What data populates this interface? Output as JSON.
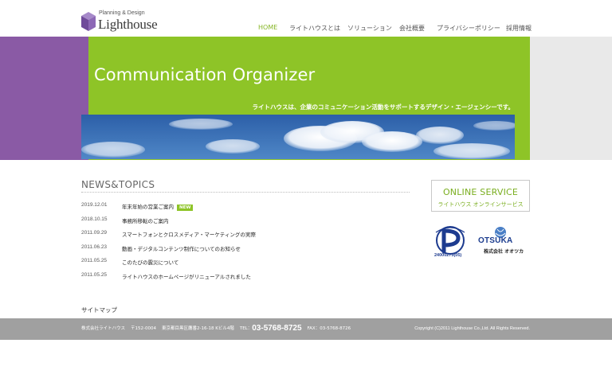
{
  "header": {
    "logo_subtitle": "Planning & Design",
    "logo_name": "Lighthouse"
  },
  "nav": [
    {
      "label": "HOME",
      "active": true
    },
    {
      "label": "ライトハウスとは"
    },
    {
      "label": "ソリューション"
    },
    {
      "label": "会社概要"
    },
    {
      "label": "プライバシーポリシー"
    },
    {
      "label": "採用情報"
    }
  ],
  "hero": {
    "title": "Communication Organizer",
    "tagline": "ライトハウスは、企業のコミュニケーション活動をサポートするデザイン・エージェンシーです。"
  },
  "news": {
    "heading": "NEWS&TOPICS",
    "new_badge": "NEW",
    "items": [
      {
        "date": "2019.12.01",
        "text": "年末年始の営業ご案内",
        "is_new": true
      },
      {
        "date": "2018.10.15",
        "text": "事務所移転のご案内"
      },
      {
        "date": "2011.09.29",
        "text": "スマートフォンとクロスメディア・マーケティングの実際"
      },
      {
        "date": "2011.06.23",
        "text": "動画・デジタルコンテンツ制作についてのお知らせ"
      },
      {
        "date": "2011.05.25",
        "text": "このたびの震災について"
      },
      {
        "date": "2011.05.25",
        "text": "ライトハウスのホームページがリニューアルされました"
      }
    ]
  },
  "online_service": {
    "title": "ONLINE SERVICE",
    "subtitle": "ライトハウス オンラインサービス"
  },
  "badges": {
    "privacy_number": "24000273(05)",
    "otsuka_name": "OTSUKA",
    "otsuka_kana": "株式会社 オオツカ"
  },
  "sitemap_label": "サイトマップ",
  "footer": {
    "company": "株式会社ライトハウス",
    "postal": "〒152-0004",
    "address": "東京都目黒区鷹番2-16-18 Kビル4階",
    "tel_label": "TEL：",
    "tel": "03-5768-8725",
    "fax": "FAX：03-5768-8726",
    "copyright": "Copyright (C)2011 Lighthouse Co.,Ltd. All Rights Reserved."
  },
  "colors": {
    "accent_green": "#8ec427",
    "purple": "#8a5aa5",
    "footer_gray": "#a0a0a0"
  }
}
